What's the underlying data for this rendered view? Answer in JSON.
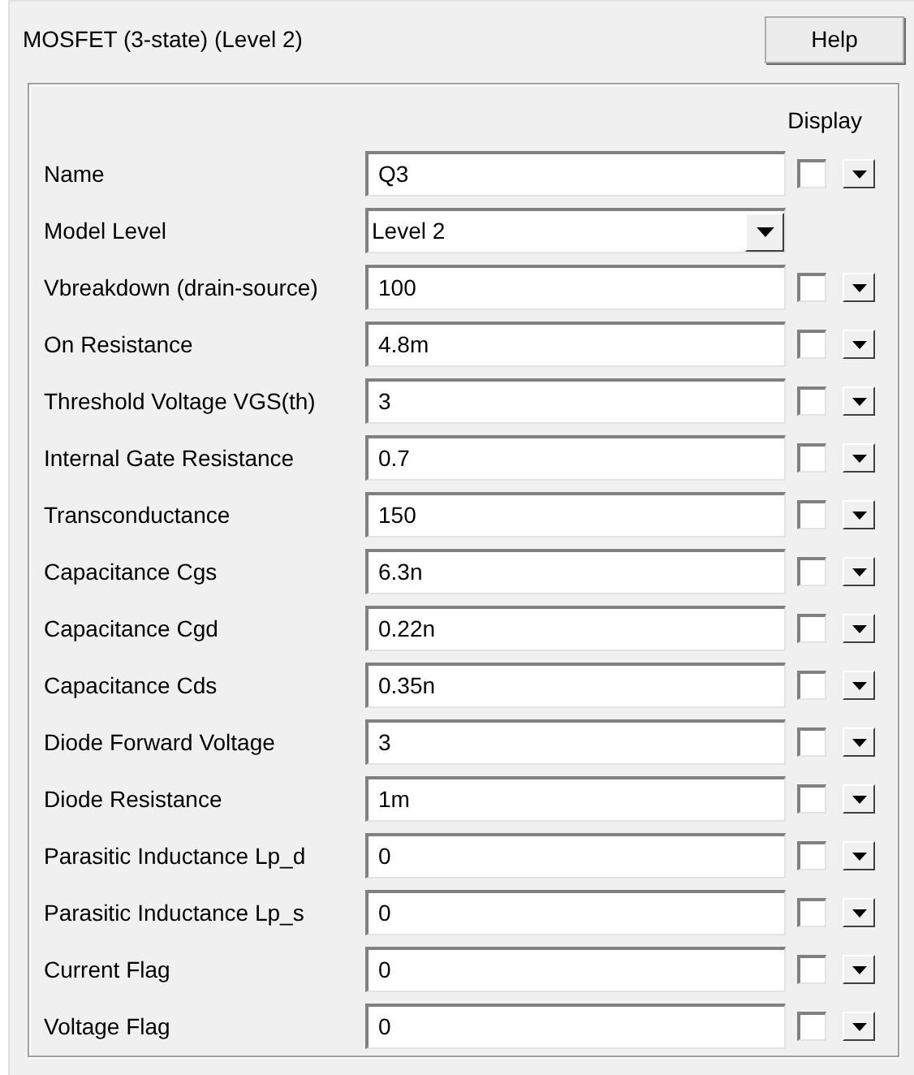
{
  "title": "MOSFET (3-state) (Level 2)",
  "help_button": "Help",
  "display_header": "Display",
  "rows": [
    {
      "kind": "field",
      "label": "Name",
      "value": "Q3",
      "checked": false
    },
    {
      "kind": "select",
      "label": "Model Level",
      "value": "Level 2"
    },
    {
      "kind": "field",
      "label": "Vbreakdown (drain-source)",
      "value": "100",
      "checked": false
    },
    {
      "kind": "field",
      "label": "On Resistance",
      "value": "4.8m",
      "checked": false
    },
    {
      "kind": "field",
      "label": "Threshold Voltage VGS(th)",
      "value": "3",
      "checked": false
    },
    {
      "kind": "field",
      "label": "Internal Gate Resistance",
      "value": "0.7",
      "checked": false
    },
    {
      "kind": "field",
      "label": "Transconductance",
      "value": "150",
      "checked": false
    },
    {
      "kind": "field",
      "label": "Capacitance Cgs",
      "value": "6.3n",
      "checked": false
    },
    {
      "kind": "field",
      "label": "Capacitance Cgd",
      "value": "0.22n",
      "checked": false
    },
    {
      "kind": "field",
      "label": "Capacitance Cds",
      "value": "0.35n",
      "checked": false
    },
    {
      "kind": "field",
      "label": "Diode Forward Voltage",
      "value": "3",
      "checked": false
    },
    {
      "kind": "field",
      "label": "Diode Resistance",
      "value": "1m",
      "checked": false
    },
    {
      "kind": "field",
      "label": "Parasitic Inductance Lp_d",
      "value": "0",
      "checked": false
    },
    {
      "kind": "field",
      "label": "Parasitic Inductance Lp_s",
      "value": "0",
      "checked": false
    },
    {
      "kind": "field",
      "label": "Current Flag",
      "value": "0",
      "checked": false
    },
    {
      "kind": "field",
      "label": "Voltage Flag",
      "value": "0",
      "checked": false
    }
  ]
}
